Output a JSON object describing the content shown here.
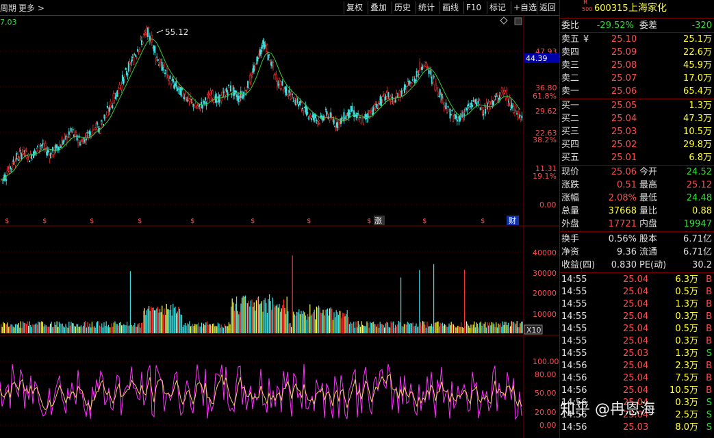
{
  "toolbar": {
    "left_text": "周期",
    "more": "更多",
    "buttons": [
      "复权",
      "叠加",
      "历史",
      "统计",
      "画线",
      "F10",
      "标记",
      "+自选",
      "返回"
    ]
  },
  "chart": {
    "top_value": "7.03",
    "high_annotation": "55.12",
    "price_axis": [
      {
        "v": "47.93",
        "c": "#ff4d4d"
      },
      {
        "v": "36.80",
        "c": "#ff4d4d"
      },
      {
        "v": "61.8%",
        "c": "#ff4d4d"
      },
      {
        "v": "29.62",
        "c": "#ff4d4d"
      },
      {
        "v": "22.63",
        "c": "#ff4d4d"
      },
      {
        "v": "38.2%",
        "c": "#ff4d4d"
      },
      {
        "v": "11.31",
        "c": "#ff4d4d"
      },
      {
        "v": "19.1%",
        "c": "#ff4d4d"
      },
      {
        "v": "0.00",
        "c": "#ff4d4d"
      }
    ],
    "current_price_tag": "44.39",
    "volume_axis": [
      "40000",
      "30000",
      "20000",
      "10000"
    ],
    "volume_unit": "X10",
    "osc_axis": [
      "100.00",
      "80.00",
      "50.00",
      "20.00",
      "0.00"
    ],
    "markers": [
      "$",
      "$",
      "$",
      "$",
      "$",
      "$",
      "$",
      "$",
      "$",
      "$"
    ],
    "marker_zhang": "涨",
    "marker_cai": "财",
    "colors": {
      "up": "#ff3030",
      "down": "#3de0e0",
      "ma": "#33cc33",
      "osc1": "#ff33ff",
      "osc2": "#ffcc66"
    },
    "price_series": [
      8,
      9,
      11,
      12,
      14,
      15,
      16,
      17,
      16,
      15,
      16,
      17,
      18,
      19,
      18,
      17,
      16,
      17,
      18,
      19,
      20,
      21,
      22,
      23,
      22,
      21,
      20,
      21,
      22,
      23,
      24,
      25,
      24,
      26,
      28,
      30,
      32,
      34,
      36,
      38,
      40,
      42,
      44,
      46,
      48,
      50,
      52,
      54,
      55,
      53,
      50,
      47,
      45,
      44,
      42,
      40,
      39,
      38,
      37,
      36,
      35,
      34,
      33,
      32,
      31,
      31,
      32,
      33,
      34,
      35,
      34,
      33,
      34,
      35,
      36,
      37,
      36,
      35,
      34,
      35,
      36,
      38,
      40,
      43,
      46,
      49,
      51,
      50,
      47,
      44,
      41,
      39,
      38,
      37,
      36,
      35,
      34,
      33,
      32,
      31,
      30,
      29,
      28,
      28,
      27,
      27,
      28,
      29,
      28,
      27,
      26,
      26,
      27,
      28,
      29,
      30,
      29,
      28,
      27,
      27,
      28,
      29,
      30,
      31,
      32,
      33,
      34,
      35,
      34,
      33,
      34,
      35,
      36,
      37,
      38,
      39,
      40,
      42,
      44,
      45,
      44,
      42,
      40,
      38,
      36,
      34,
      32,
      30,
      29,
      28,
      27,
      28,
      29,
      30,
      31,
      32,
      33,
      32,
      31,
      30,
      31,
      32,
      33,
      34,
      35,
      36,
      35,
      33,
      31,
      30,
      29,
      28
    ]
  },
  "quote": {
    "logo_top": "R",
    "logo_bottom": "500",
    "code": "600315",
    "name": "上海家化",
    "weibi_label": "委比",
    "weibi_value": "-29.52%",
    "weicha_label": "委差",
    "weicha_value": "-320",
    "sell": [
      {
        "label": "卖五",
        "flag": "¥",
        "price": "25.10",
        "vol": "25.1万"
      },
      {
        "label": "卖四",
        "flag": "",
        "price": "25.09",
        "vol": "22.6万"
      },
      {
        "label": "卖三",
        "flag": "",
        "price": "25.08",
        "vol": "45.9万"
      },
      {
        "label": "卖二",
        "flag": "",
        "price": "25.07",
        "vol": "17.0万"
      },
      {
        "label": "卖一",
        "flag": "",
        "price": "25.06",
        "vol": "65.4万"
      }
    ],
    "buy": [
      {
        "label": "买一",
        "price": "25.05",
        "vol": "1.3万"
      },
      {
        "label": "买二",
        "price": "25.04",
        "vol": "47.3万"
      },
      {
        "label": "买三",
        "price": "25.03",
        "vol": "10.5万"
      },
      {
        "label": "买四",
        "price": "25.02",
        "vol": "29.8万"
      },
      {
        "label": "买五",
        "price": "25.01",
        "vol": "6.8万"
      }
    ],
    "stats": [
      {
        "l1": "现价",
        "v1": "25.06",
        "c1": "red",
        "l2": "今开",
        "v2": "24.52",
        "c2": "green"
      },
      {
        "l1": "涨跌",
        "v1": "0.51",
        "c1": "red",
        "l2": "最高",
        "v2": "25.12",
        "c2": "red"
      },
      {
        "l1": "涨幅",
        "v1": "2.08%",
        "c1": "red",
        "l2": "最低",
        "v2": "24.48",
        "c2": "green"
      },
      {
        "l1": "总量",
        "v1": "37668",
        "c1": "yellow",
        "l2": "量比",
        "v2": "0.88",
        "c2": "yellow"
      },
      {
        "l1": "外盘",
        "v1": "17721",
        "c1": "red",
        "l2": "内盘",
        "v2": "19947",
        "c2": "green"
      }
    ],
    "fundamentals": [
      {
        "l1": "换手",
        "v1": "0.56%",
        "l2": "股本",
        "v2": "6.71亿"
      },
      {
        "l1": "净资",
        "v1": "9.36",
        "l2": "流通",
        "v2": "6.71亿"
      },
      {
        "l1": "收益(四)",
        "v1": "0.830",
        "l2": "PE(动)",
        "v2": "30.2"
      }
    ],
    "ticks": [
      {
        "t": "14:55",
        "p": "25.04",
        "v": "6.3万",
        "s": "B"
      },
      {
        "t": "14:55",
        "p": "25.04",
        "v": "0.5万",
        "s": "B"
      },
      {
        "t": "14:55",
        "p": "25.04",
        "v": "1.3万",
        "s": "B"
      },
      {
        "t": "14:55",
        "p": "25.04",
        "v": "0.3万",
        "s": "B"
      },
      {
        "t": "14:55",
        "p": "25.04",
        "v": "0.5万",
        "s": "B"
      },
      {
        "t": "14:55",
        "p": "25.04",
        "v": "0.3万",
        "s": "B"
      },
      {
        "t": "14:55",
        "p": "25.03",
        "v": "1.3万",
        "s": "S"
      },
      {
        "t": "14:56",
        "p": "25.04",
        "v": "2.3万",
        "s": "B"
      },
      {
        "t": "14:56",
        "p": "25.04",
        "v": "7.5万",
        "s": "B"
      },
      {
        "t": "14:56",
        "p": "25.04",
        "v": "10.5万",
        "s": "B"
      },
      {
        "t": "14:56",
        "p": "25.04",
        "v": "0.3万",
        "s": "S"
      },
      {
        "t": "14:56",
        "p": "25.04",
        "v": "2.5万",
        "s": "S"
      },
      {
        "t": "14:56",
        "p": "25.03",
        "v": "8.0万",
        "s": "S"
      }
    ]
  },
  "watermark": "知乎 @冉恩海"
}
